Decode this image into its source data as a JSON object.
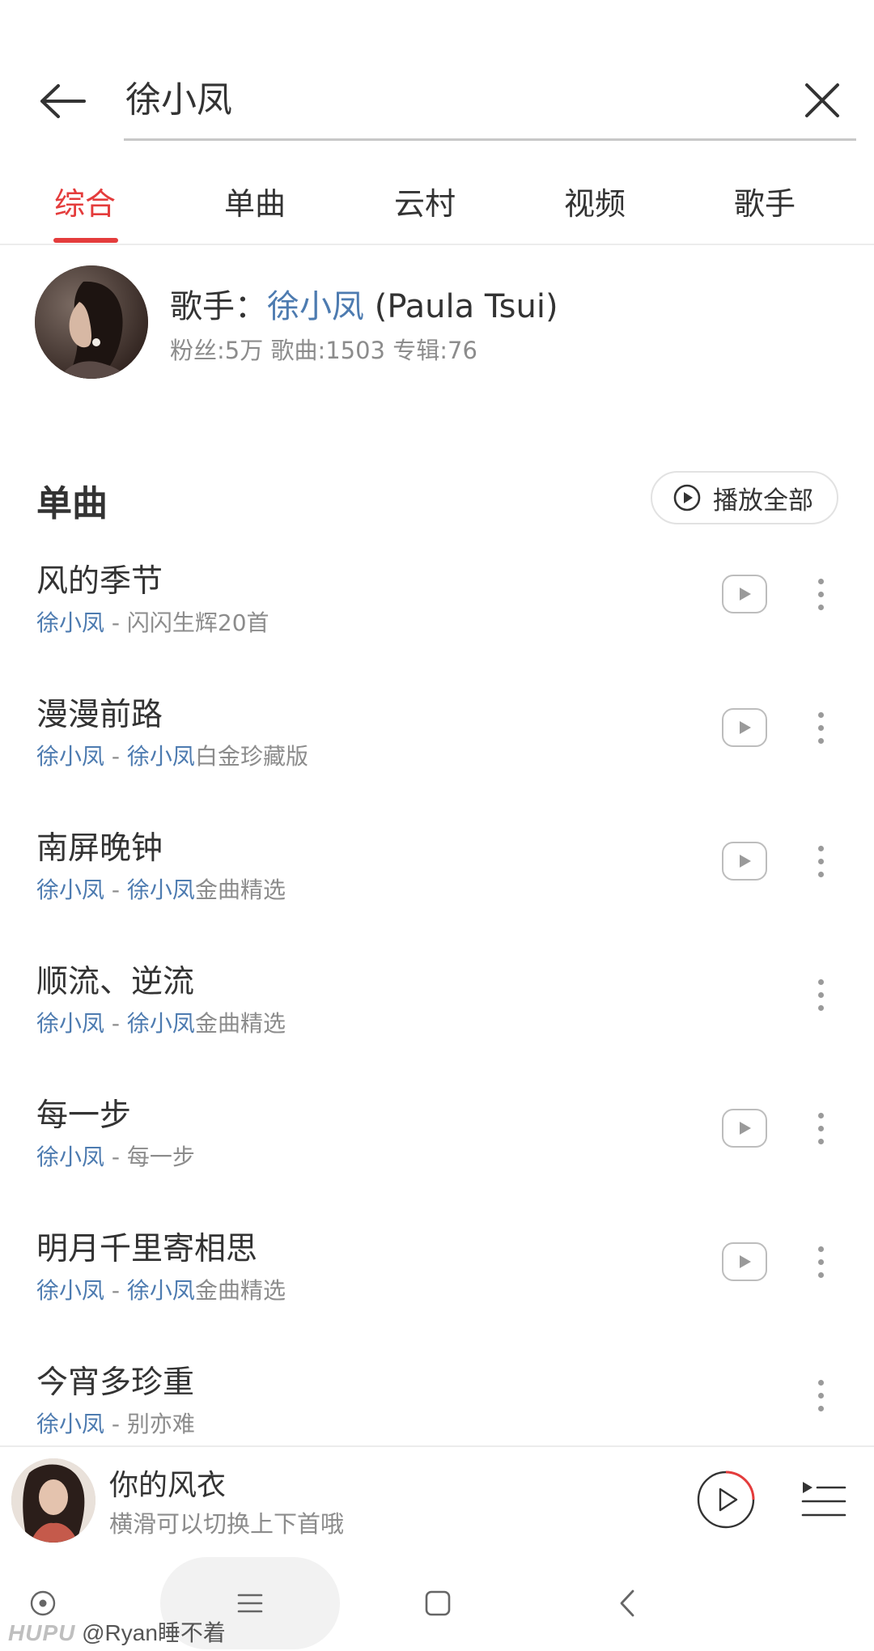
{
  "search": {
    "query": "徐小凤"
  },
  "tabs": [
    {
      "label": "综合",
      "active": true
    },
    {
      "label": "单曲",
      "active": false
    },
    {
      "label": "云村",
      "active": false
    },
    {
      "label": "视频",
      "active": false
    },
    {
      "label": "歌手",
      "active": false
    }
  ],
  "artist": {
    "prefix": "歌手：",
    "name": "徐小凤",
    "alias": " (Paula Tsui)",
    "stats": "粉丝:5万 歌曲:1503 专辑:76"
  },
  "songs_section": {
    "title": "单曲",
    "play_all_label": "播放全部",
    "items": [
      {
        "title": "风的季节",
        "artist": "徐小凤",
        "sep": " - ",
        "album_hl": "",
        "album": "闪闪生辉20首",
        "has_mv": true
      },
      {
        "title": "漫漫前路",
        "artist": "徐小凤",
        "sep": " - ",
        "album_hl": "徐小凤",
        "album": "白金珍藏版",
        "has_mv": true
      },
      {
        "title": "南屏晚钟",
        "artist": "徐小凤",
        "sep": " - ",
        "album_hl": "徐小凤",
        "album": "金曲精选",
        "has_mv": true
      },
      {
        "title": "顺流、逆流",
        "artist": "徐小凤",
        "sep": " - ",
        "album_hl": "徐小凤",
        "album": "金曲精选",
        "has_mv": false
      },
      {
        "title": "每一步",
        "artist": "徐小凤",
        "sep": " - ",
        "album_hl": "",
        "album": "每一步",
        "has_mv": true
      },
      {
        "title": "明月千里寄相思",
        "artist": "徐小凤",
        "sep": " - ",
        "album_hl": "徐小凤",
        "album": "金曲精选",
        "has_mv": true
      },
      {
        "title": "今宵多珍重",
        "artist": "徐小凤",
        "sep": " - ",
        "album_hl": "",
        "album": "别亦难",
        "has_mv": false
      }
    ]
  },
  "player": {
    "title": "你的风衣",
    "subtitle": "横滑可以切换上下首哦"
  },
  "watermark": {
    "brand": "HUPU",
    "user": " @Ryan睡不着"
  },
  "colors": {
    "accent": "#e43c3c",
    "link": "#4d7bb0",
    "muted": "#8c8c8c"
  }
}
